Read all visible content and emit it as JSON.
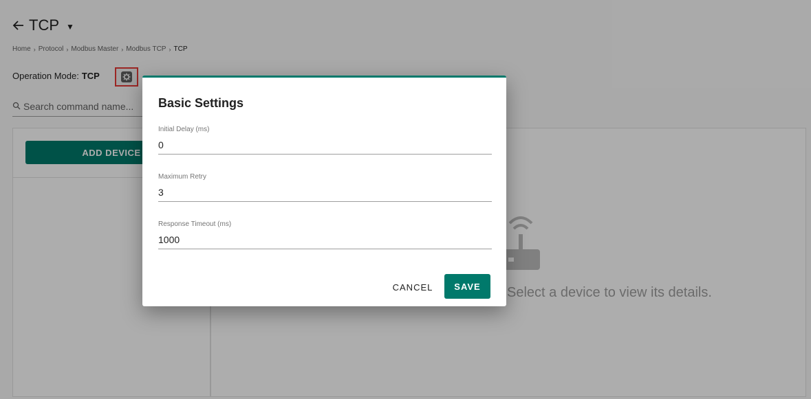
{
  "header": {
    "title": "TCP",
    "back_icon": "arrow-left-icon",
    "menu_icon": "caret-down-icon"
  },
  "breadcrumb": [
    "Home",
    "Protocol",
    "Modbus Master",
    "Modbus TCP",
    "TCP"
  ],
  "operation_mode": {
    "label": "Operation Mode:",
    "value": "TCP",
    "settings_icon": "gear-icon"
  },
  "search": {
    "placeholder": "Search command name...",
    "icon": "search-icon"
  },
  "left_panel": {
    "add_device_label": "ADD DEVICE"
  },
  "right_panel": {
    "empty_icon": "router-wifi-icon",
    "empty_text": "Select a device to view its details."
  },
  "dialog": {
    "title": "Basic Settings",
    "fields": [
      {
        "label": "Initial Delay (ms)",
        "value": "0"
      },
      {
        "label": "Maximum Retry",
        "value": "3"
      },
      {
        "label": "Response Timeout (ms)",
        "value": "1000"
      }
    ],
    "cancel_label": "CANCEL",
    "save_label": "SAVE"
  },
  "colors": {
    "primary": "#00796b",
    "highlight": "#e53935"
  }
}
